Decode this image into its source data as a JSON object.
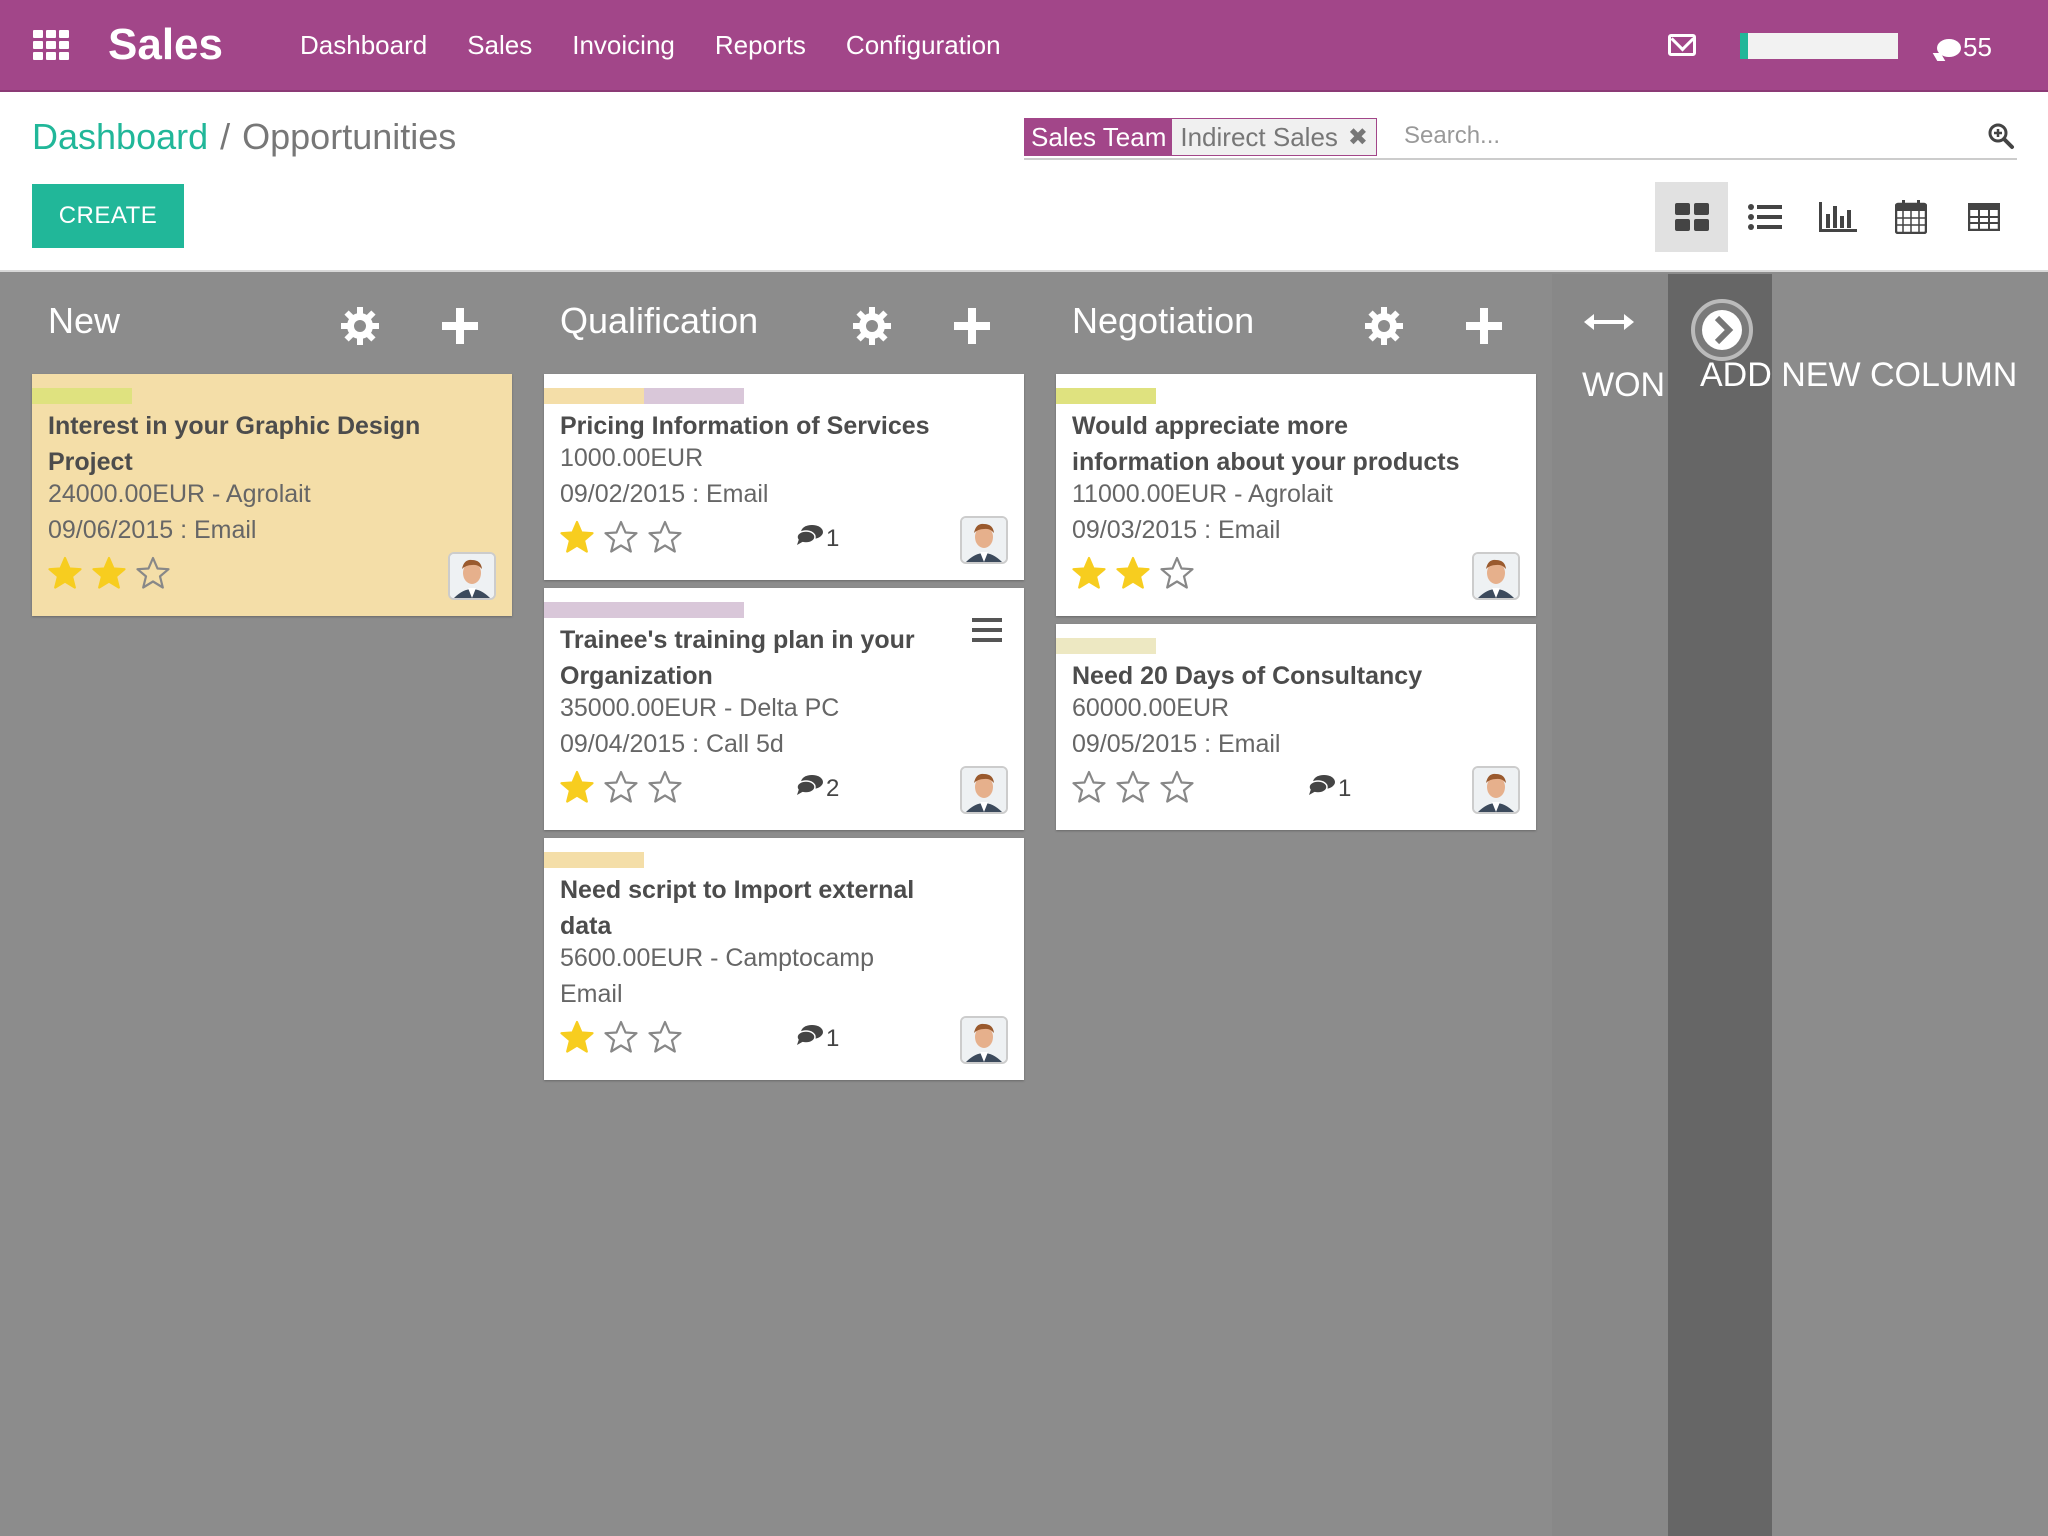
{
  "topbar": {
    "app_title": "Sales",
    "menu": [
      "Dashboard",
      "Sales",
      "Invoicing",
      "Reports",
      "Configuration"
    ],
    "chat_count": "55",
    "brand_color": "#a24689"
  },
  "breadcrumb": {
    "parent": "Dashboard",
    "separator": "/",
    "current": "Opportunities"
  },
  "toolbar": {
    "create_label": "CREATE"
  },
  "search": {
    "facet_label": "Sales Team",
    "facet_value": "Indirect Sales",
    "facet_remove": "✖",
    "placeholder": "Search..."
  },
  "views": [
    "kanban-icon",
    "list-icon",
    "graph-icon",
    "calendar-icon",
    "pivot-icon"
  ],
  "columns": [
    {
      "title": "New",
      "cards": [
        {
          "title_lines": [
            "Interest in your Graphic Design",
            "Project"
          ],
          "line1": "24000.00EUR - Agrolait",
          "line2": "09/06/2015 : Email",
          "stars": 2,
          "msgs": "",
          "tags": [
            "#dfe27f"
          ]
        }
      ]
    },
    {
      "title": "Qualification",
      "cards": [
        {
          "title_lines": [
            "Pricing Information of Services"
          ],
          "line1": "1000.00EUR",
          "line2": "09/02/2015 : Email",
          "stars": 1,
          "msgs": "1",
          "tags": [
            "#f4dea8",
            "#d9c7d9"
          ]
        },
        {
          "title_lines": [
            "Trainee's training plan in your",
            "Organization"
          ],
          "line1": "35000.00EUR - Delta PC",
          "line2": "09/04/2015 : Call 5d",
          "stars": 1,
          "msgs": "2",
          "tags": [
            "#d9c7d9",
            "#d9c7d9"
          ]
        },
        {
          "title_lines": [
            "Need script to Import external",
            "data"
          ],
          "line1": "5600.00EUR - Camptocamp",
          "line2": "Email",
          "stars": 1,
          "msgs": "1",
          "tags": [
            "#f4dea8"
          ]
        }
      ]
    },
    {
      "title": "Negotiation",
      "cards": [
        {
          "title_lines": [
            "Would appreciate more",
            "information about your products"
          ],
          "line1": "11000.00EUR - Agrolait",
          "line2": "09/03/2015 : Email",
          "stars": 2,
          "msgs": "",
          "tags": [
            "#dfe27f"
          ]
        },
        {
          "title_lines": [
            "Need 20 Days of Consultancy"
          ],
          "line1": "60000.00EUR",
          "line2": "09/05/2015 : Email",
          "stars": 0,
          "msgs": "1",
          "tags": [
            "#ede8c2"
          ]
        }
      ]
    }
  ],
  "won": {
    "label": "WON"
  },
  "add_column": {
    "label": "ADD NEW COLUMN"
  },
  "colors": {
    "accent": "#21b799",
    "star": "#f7cd1f",
    "column_bg": "#8c8c8c"
  }
}
